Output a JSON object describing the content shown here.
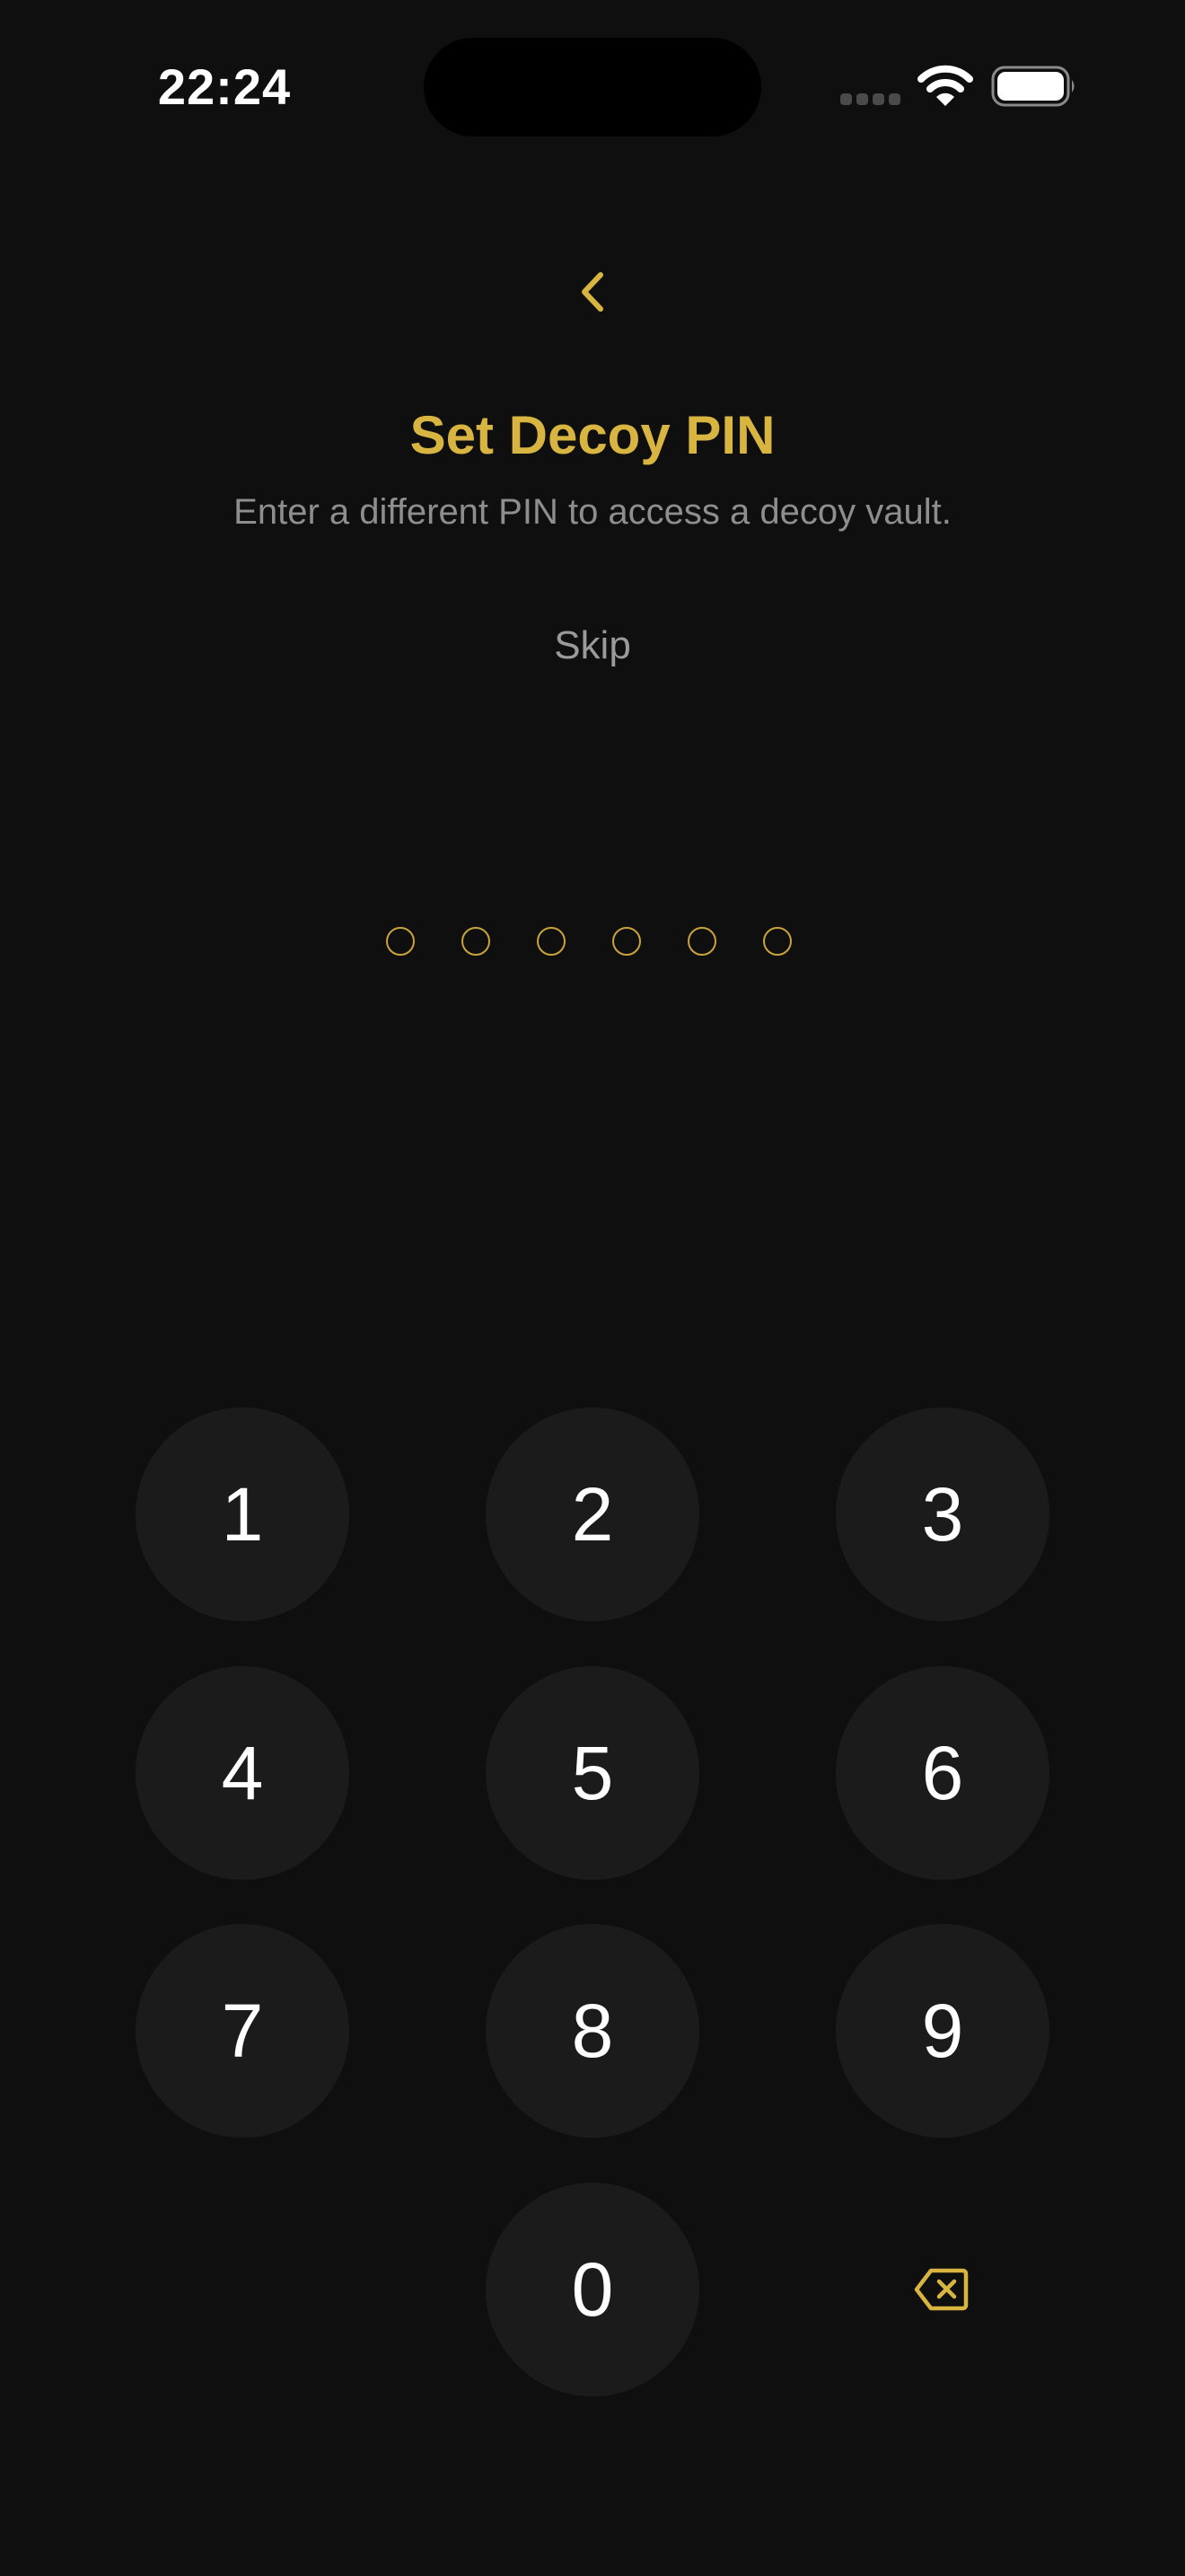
{
  "status_bar": {
    "time": "22:24"
  },
  "header": {
    "back_icon": "chevron-left-icon",
    "title": "Set Decoy PIN",
    "subtitle": "Enter a different PIN to access a decoy vault.",
    "skip_label": "Skip"
  },
  "pin": {
    "length": 6,
    "entered": 0
  },
  "keypad": {
    "keys": [
      "1",
      "2",
      "3",
      "4",
      "5",
      "6",
      "7",
      "8",
      "9",
      "0"
    ],
    "delete_icon": "backspace-icon"
  },
  "colors": {
    "accent": "#d8b441",
    "background": "#0f0f0f",
    "key_fill": "#1b1b1b"
  }
}
